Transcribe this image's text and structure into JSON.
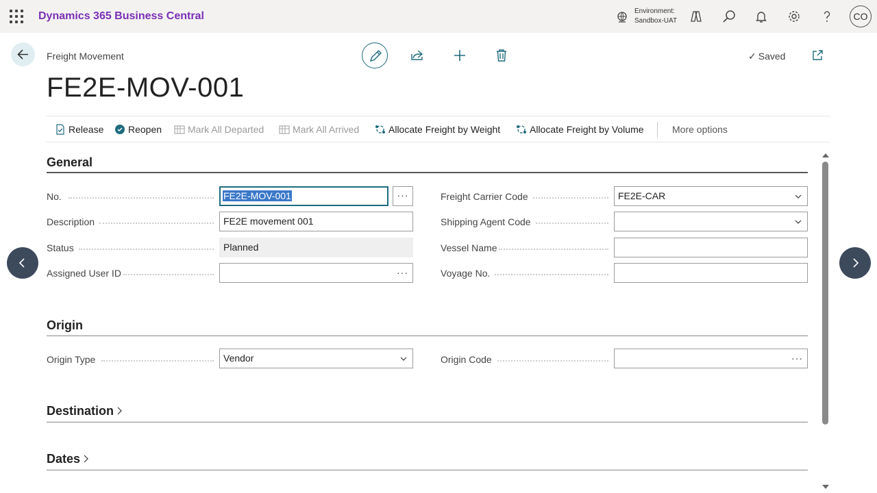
{
  "topbar": {
    "app_title": "Dynamics 365 Business Central",
    "environment_label": "Environment:",
    "environment_value": "Sandbox-UAT",
    "avatar_initials": "CO"
  },
  "header": {
    "breadcrumb": "Freight Movement",
    "title": "FE2E-MOV-001",
    "saved_label": "Saved"
  },
  "actions": {
    "release": "Release",
    "reopen": "Reopen",
    "mark_all_departed": "Mark All Departed",
    "mark_all_arrived": "Mark All Arrived",
    "allocate_weight": "Allocate Freight by Weight",
    "allocate_volume": "Allocate Freight by Volume",
    "more_options": "More options"
  },
  "general": {
    "title": "General",
    "no_label": "No.",
    "no_value": "FE2E-MOV-001",
    "description_label": "Description",
    "description_value": "FE2E movement 001",
    "status_label": "Status",
    "status_value": "Planned",
    "assigned_user_label": "Assigned User ID",
    "assigned_user_value": "",
    "carrier_label": "Freight Carrier Code",
    "carrier_value": "FE2E-CAR",
    "agent_label": "Shipping Agent Code",
    "agent_value": "",
    "vessel_label": "Vessel Name",
    "vessel_value": "",
    "voyage_label": "Voyage No.",
    "voyage_value": ""
  },
  "origin": {
    "title": "Origin",
    "type_label": "Origin Type",
    "type_value": "Vendor",
    "code_label": "Origin Code",
    "code_value": ""
  },
  "destination": {
    "title": "Destination"
  },
  "dates": {
    "title": "Dates"
  },
  "colors": {
    "accent": "#1e6b7e",
    "brand": "#7a2fb5",
    "nav_circle": "#3d4a5c"
  }
}
